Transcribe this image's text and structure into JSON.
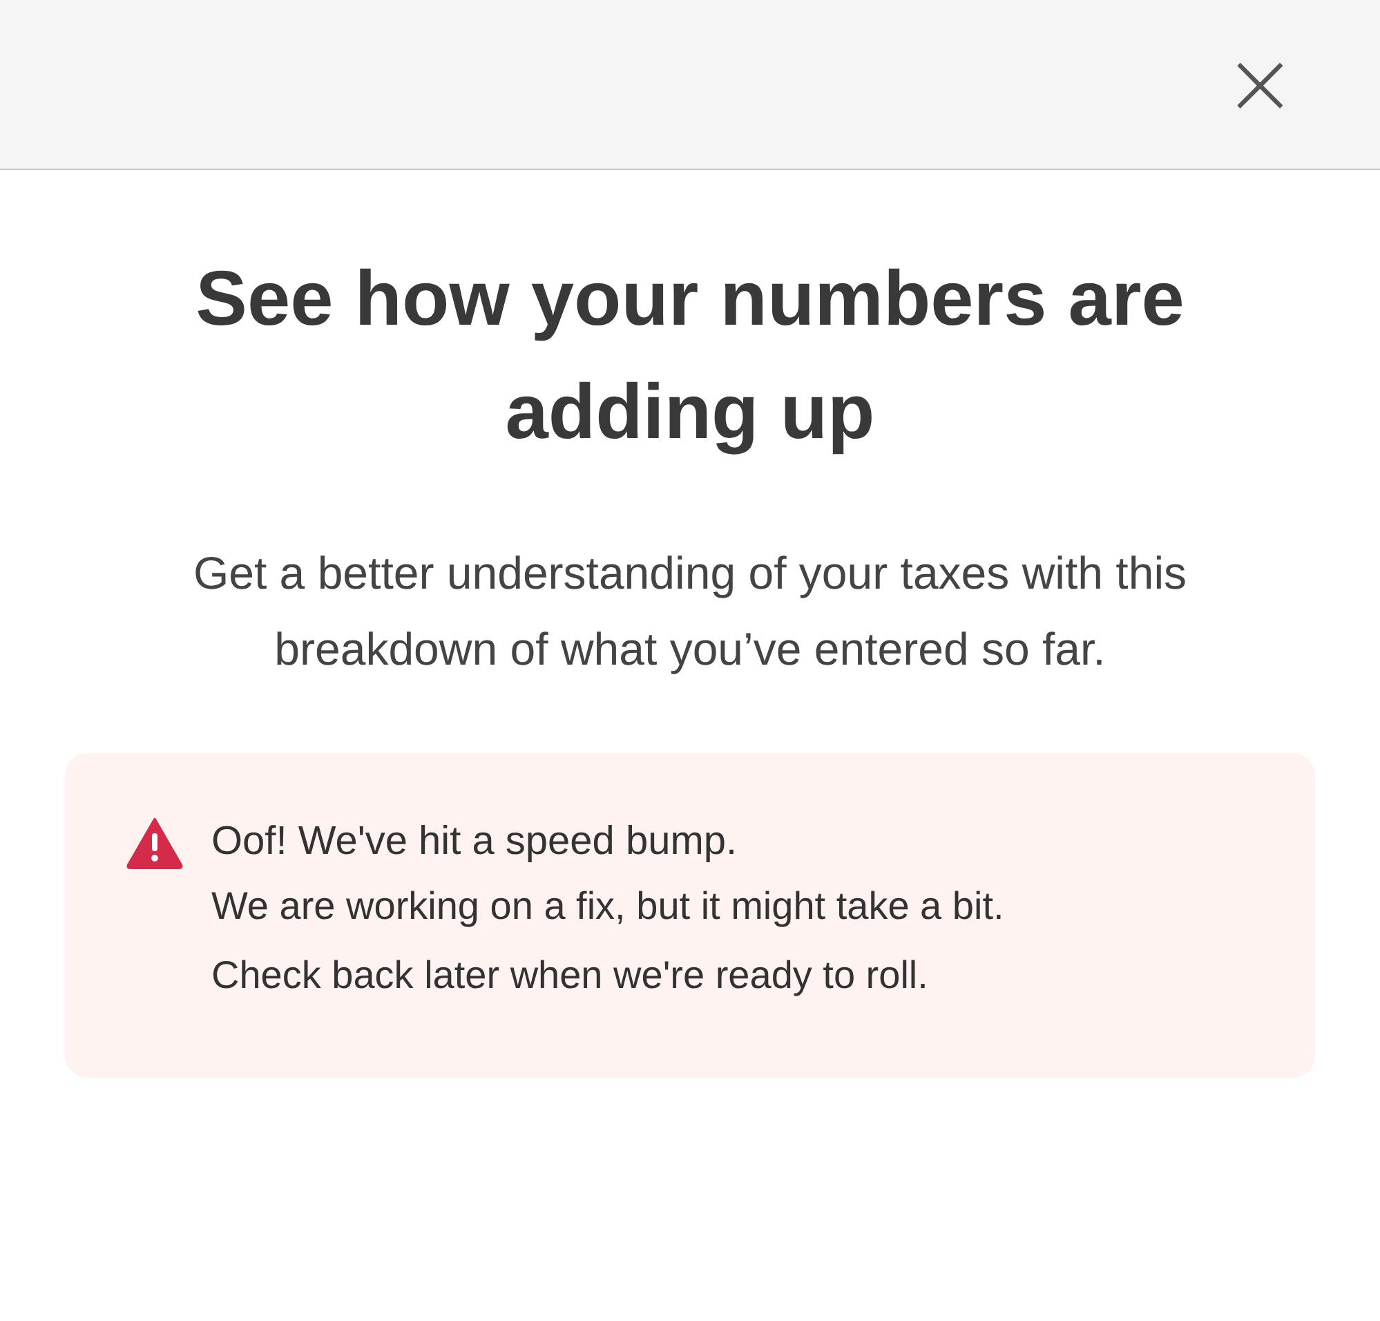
{
  "header": {
    "close": "×"
  },
  "title": "See how your numbers are adding up",
  "subtitle": "Get a better understanding of your taxes with this breakdown of what you’ve entered so far.",
  "alert": {
    "kind": "error",
    "title": "Oof! We've hit a speed bump.",
    "lines": [
      "We are working on a fix, but it might take a bit.",
      "Check back later when we're ready to roll."
    ]
  }
}
